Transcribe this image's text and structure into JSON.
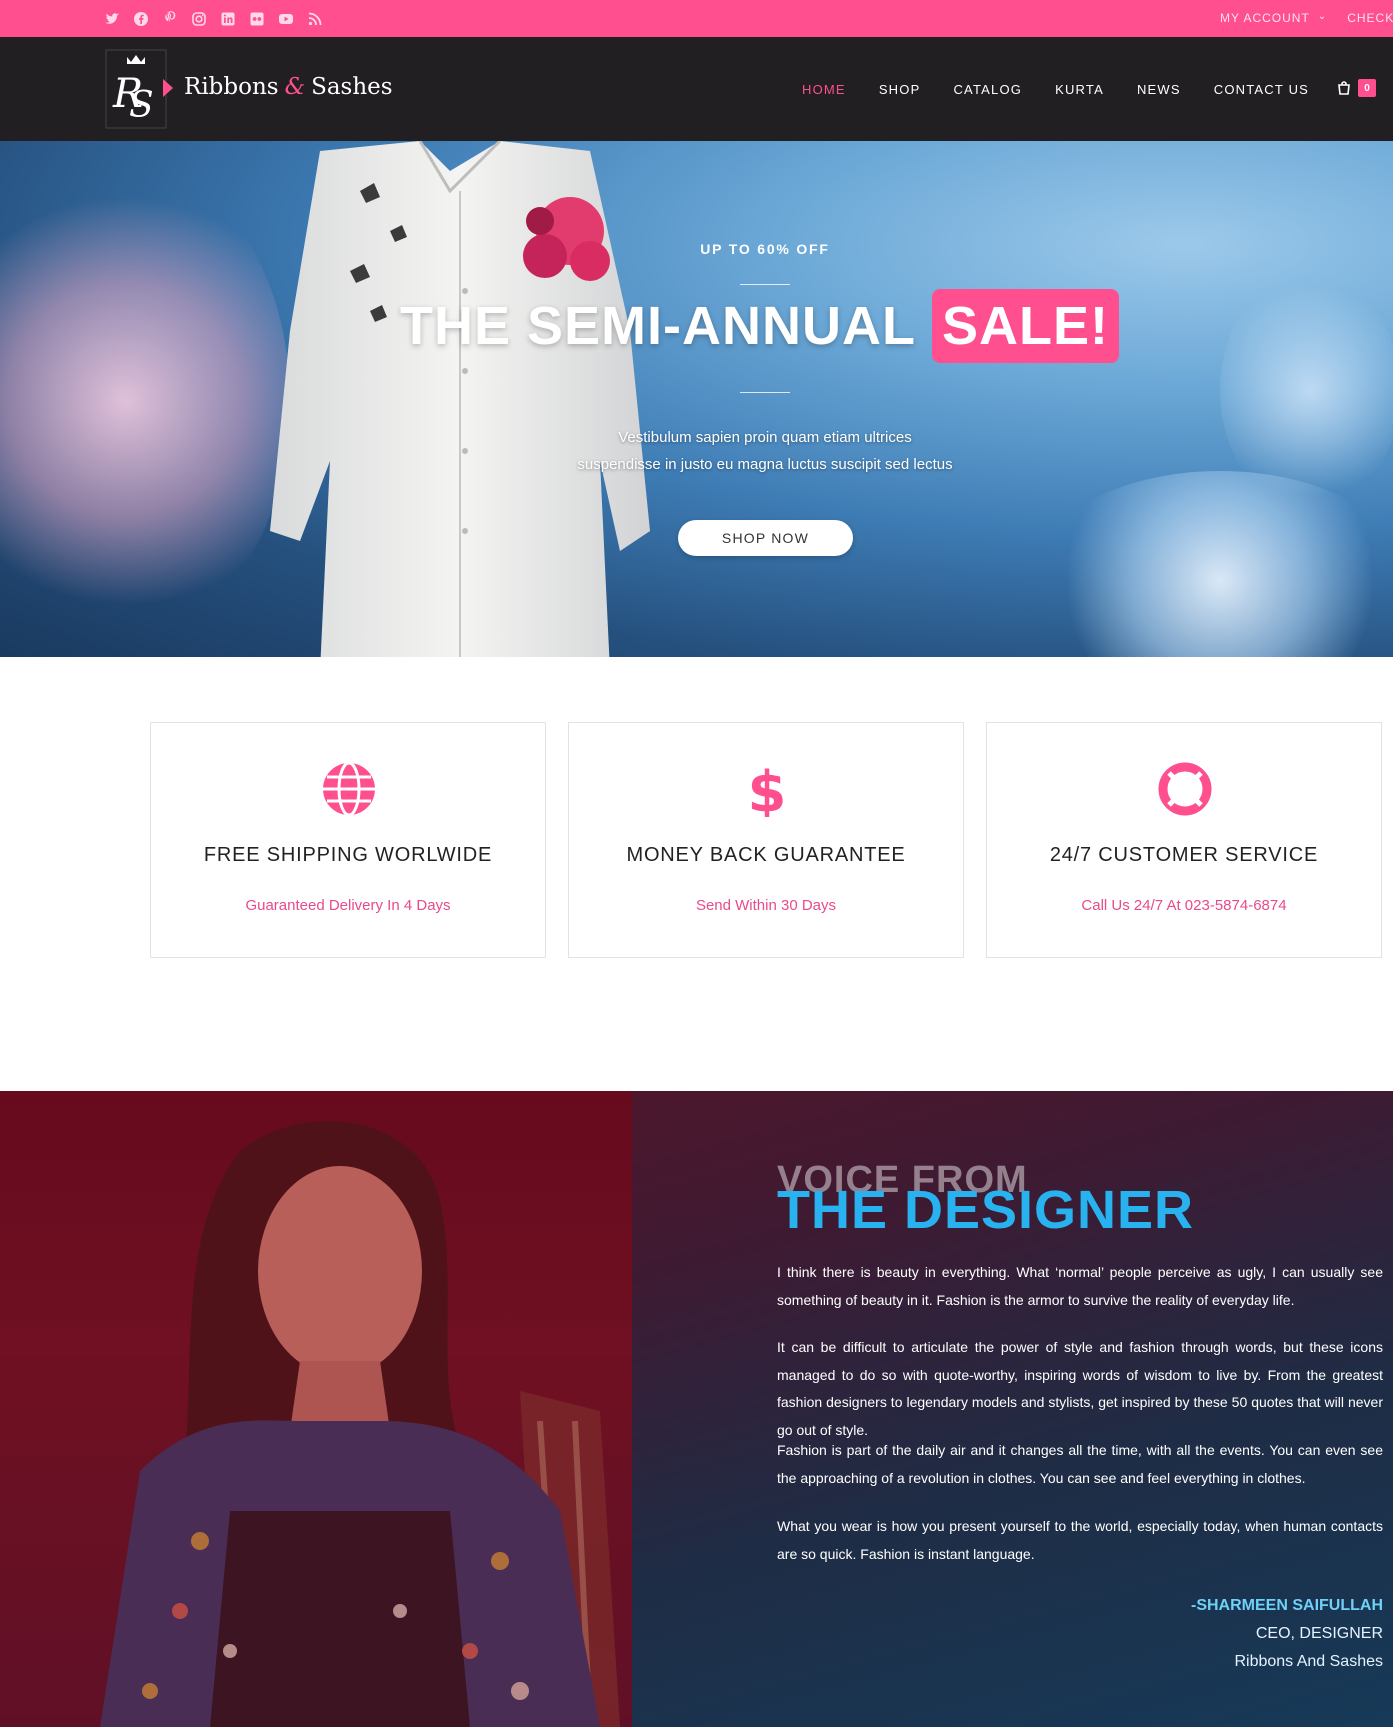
{
  "topbar": {
    "socials": [
      "twitter-icon",
      "facebook-icon",
      "pinterest-icon",
      "instagram-icon",
      "linkedin-icon",
      "flickr-icon",
      "youtube-icon",
      "rss-icon"
    ],
    "account_label": "MY ACCOUNT",
    "checkout_label": "CHECK"
  },
  "nav": {
    "brand_part1": "Ribbons",
    "brand_amp": "&",
    "brand_part2": "Sashes",
    "items": [
      "HOME",
      "SHOP",
      "CATALOG",
      "KURTA",
      "NEWS",
      "CONTACT US"
    ],
    "active_item": "HOME",
    "cart_count": "0"
  },
  "hero": {
    "kicker": "UP TO 60% OFF",
    "title": "THE SEMI-ANNUAL",
    "title_highlight": "SALE!",
    "subtitle_line1": "Vestibulum sapien proin quam etiam ultrices",
    "subtitle_line2": "suspendisse in justo eu magna luctus suscipit sed lectus",
    "button_label": "SHOP NOW"
  },
  "features": [
    {
      "icon": "globe-icon",
      "title": "FREE SHIPPING WORLWIDE",
      "text": "Guaranteed Delivery In 4 Days"
    },
    {
      "icon": "dollar-icon",
      "title": "MONEY BACK GUARANTEE",
      "text": "Send Within 30 Days"
    },
    {
      "icon": "lifebuoy-icon",
      "title": "24/7 CUSTOMER SERVICE",
      "text": "Call Us 24/7 At 023-5874-6874"
    }
  ],
  "designer": {
    "kicker": "VOICE FROM",
    "title": "THE DESIGNER",
    "paragraphs": [
      "I think there is beauty in everything. What ‘normal’ people perceive as ugly, I can usually see something of beauty in it. Fashion is the armor to survive the reality of everyday life.",
      "It can be difficult to articulate the power of style and fashion through words, but these icons managed to do so with quote-worthy, inspiring words of wisdom to live by. From the greatest fashion designers to legendary models and stylists, get inspired by these 50 quotes that will never go out of style.",
      "Fashion is part of the daily air and it changes all the time, with all the events. You can even see the approaching of a revolution in clothes. You can see and feel everything in clothes.",
      "What you wear is how you present yourself to the world, especially today, when human contacts are so quick. Fashion is instant language."
    ],
    "signature_name": "-SHARMEEN SAIFULLAH",
    "signature_role": "CEO, DESIGNER",
    "signature_company": "Ribbons And Sashes"
  },
  "colors": {
    "accent": "#ff4f8f",
    "nav_bg": "#221f22",
    "designer_title": "#28b3f0"
  }
}
